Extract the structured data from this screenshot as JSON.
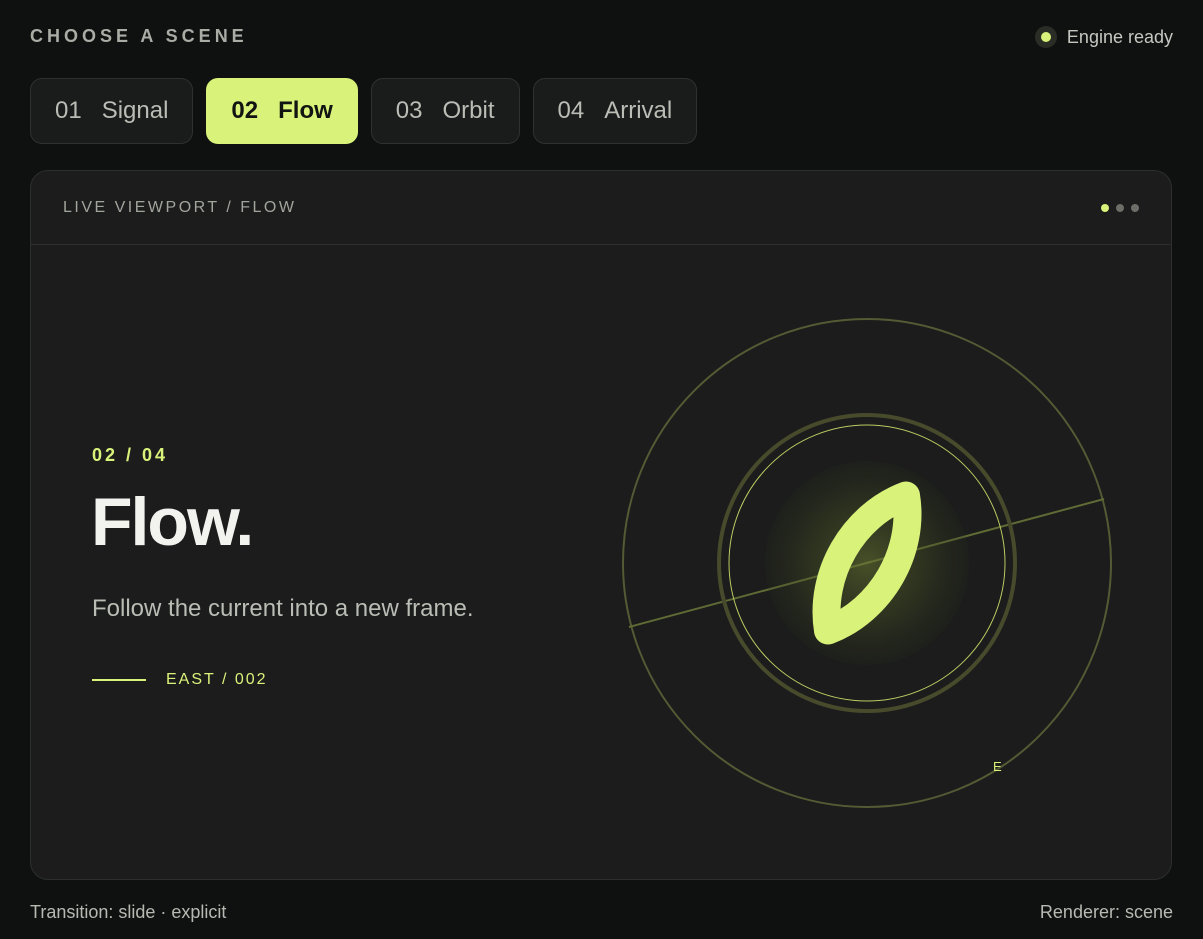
{
  "header": {
    "title": "CHOOSE A SCENE",
    "status_label": "Engine ready"
  },
  "tabs": [
    {
      "num": "01",
      "label": "Signal",
      "active": false
    },
    {
      "num": "02",
      "label": "Flow",
      "active": true
    },
    {
      "num": "03",
      "label": "Orbit",
      "active": false
    },
    {
      "num": "04",
      "label": "Arrival",
      "active": false
    }
  ],
  "viewport": {
    "title": "LIVE VIEWPORT / FLOW",
    "scene": {
      "counter": "02 / 04",
      "title": "Flow.",
      "description": "Follow the current into a new frame.",
      "coordinate": "EAST / 002",
      "compass_label": "E"
    }
  },
  "footer": {
    "transition": "Transition: slide · explicit",
    "renderer": "Renderer: scene"
  },
  "colors": {
    "accent": "#d9f27a",
    "background": "#0f1110",
    "panel": "#1b1c1b"
  },
  "icons": {
    "status": "status-dot-icon",
    "scene_mark": "leaf-icon"
  }
}
